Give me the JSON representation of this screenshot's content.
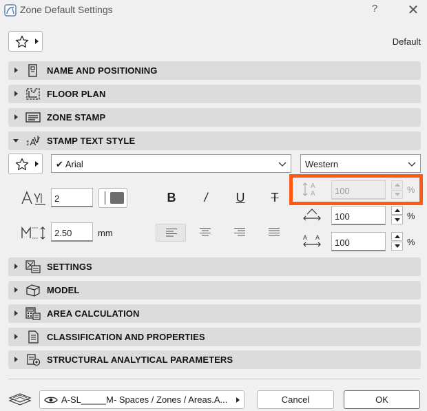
{
  "window": {
    "title": "Zone Default Settings",
    "help": "?",
    "close": "✕"
  },
  "header": {
    "favorites_icon": "star-icon",
    "default_label": "Default"
  },
  "panels": [
    {
      "label": "NAME AND POSITIONING",
      "icon": "name-positioning-icon",
      "expanded": false
    },
    {
      "label": "FLOOR PLAN",
      "icon": "floor-plan-icon",
      "expanded": false
    },
    {
      "label": "ZONE STAMP",
      "icon": "zone-stamp-icon",
      "expanded": false
    },
    {
      "label": "STAMP TEXT STYLE",
      "icon": "text-style-icon",
      "expanded": true
    },
    {
      "label": "SETTINGS",
      "icon": "settings-icon",
      "expanded": false
    },
    {
      "label": "MODEL",
      "icon": "model-icon",
      "expanded": false
    },
    {
      "label": "AREA CALCULATION",
      "icon": "calculator-icon",
      "expanded": false
    },
    {
      "label": "CLASSIFICATION AND PROPERTIES",
      "icon": "classification-icon",
      "expanded": false
    },
    {
      "label": "STRUCTURAL ANALYTICAL PARAMETERS",
      "icon": "structural-icon",
      "expanded": false
    }
  ],
  "text_style": {
    "font_check": "✔",
    "font": "Arial",
    "script": "Western",
    "pen": "2",
    "size": "2.50",
    "size_unit": "mm",
    "bold": "B",
    "italic": "/",
    "underline": "U",
    "strikethrough": "T",
    "line_spacing": "100",
    "char_spacing": "100",
    "char_width": "100",
    "percent": "%",
    "line_spacing_disabled": true,
    "alignment_active": "left",
    "accent_color": "#ff5a14"
  },
  "footer": {
    "layer": "A-SL_____M- Spaces / Zones / Areas.A...",
    "cancel": "Cancel",
    "ok": "OK"
  }
}
